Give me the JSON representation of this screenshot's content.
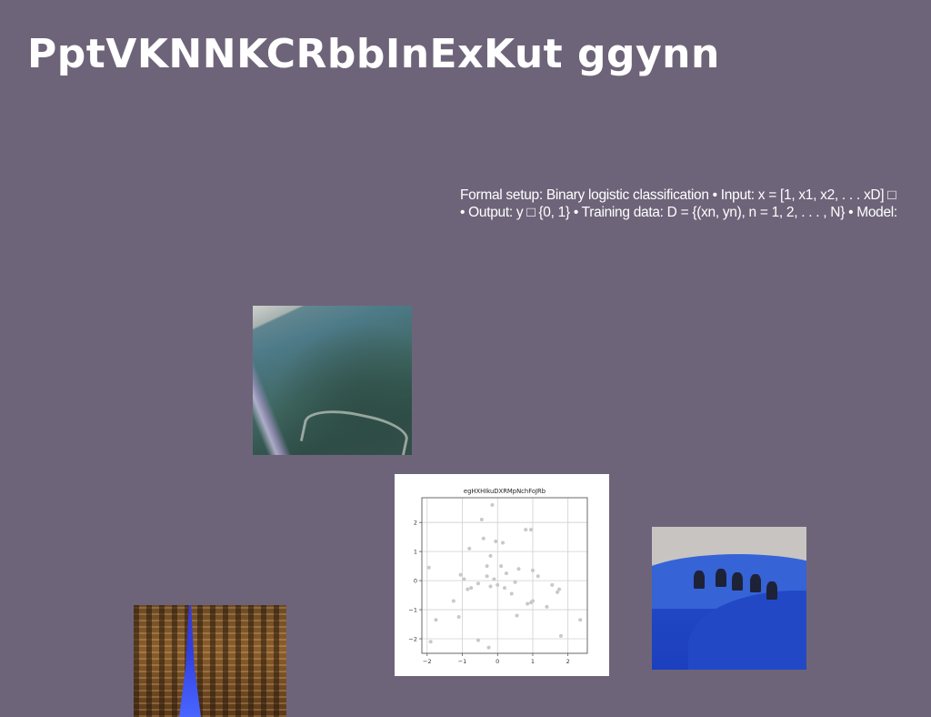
{
  "slide": {
    "title": "PptVKNNKCRbbInExKut ggynn",
    "body_line1": "Formal setup: Binary logistic classification • Input: x = [1, x1, x2, . . . xD] □",
    "body_line2": "• Output: y □ {0, 1} • Training data: D = {(xn, yn), n = 1, 2, . . . , N} • Model:"
  },
  "images": [
    {
      "name": "mountain-photo",
      "subject": "aerial mountain slope with road"
    },
    {
      "name": "camels-photo",
      "subject": "camel caravan on blue-toned dunes"
    },
    {
      "name": "city-photo",
      "subject": "night city with illuminated tower"
    }
  ],
  "chart_data": {
    "type": "scatter",
    "title": "egHXHIkuDXRMpNchFoJRb",
    "xlabel": "",
    "ylabel": "",
    "xlim": [
      -2.15,
      2.55
    ],
    "ylim": [
      -2.5,
      2.85
    ],
    "xticks": [
      "−2",
      "−1",
      "0",
      "1",
      "2"
    ],
    "xtick_values": [
      -2,
      -1,
      0,
      1,
      2
    ],
    "yticks": [
      "−2",
      "−1",
      "0",
      "1",
      "2"
    ],
    "ytick_values": [
      -2,
      -1,
      0,
      1,
      2
    ],
    "grid": true,
    "point_color": "#c8c8c8",
    "x": [
      -1.95,
      -1.9,
      -1.75,
      -1.25,
      -1.1,
      -1.05,
      -0.95,
      -0.85,
      -0.8,
      -0.75,
      -0.55,
      -0.55,
      -0.45,
      -0.4,
      -0.3,
      -0.3,
      -0.25,
      -0.2,
      -0.2,
      -0.15,
      -0.1,
      -0.05,
      0.0,
      0.1,
      0.15,
      0.2,
      0.25,
      0.4,
      0.5,
      0.55,
      0.6,
      0.8,
      0.85,
      0.95,
      0.95,
      1.0,
      1.0,
      1.15,
      1.4,
      1.55,
      1.7,
      1.75,
      1.8,
      2.35
    ],
    "y": [
      0.45,
      -2.1,
      -1.35,
      -0.7,
      -1.25,
      0.2,
      0.05,
      -0.3,
      1.1,
      -0.25,
      -0.1,
      -2.05,
      2.1,
      1.45,
      0.15,
      0.5,
      -2.3,
      0.85,
      -0.2,
      2.6,
      0.05,
      1.35,
      -0.15,
      0.5,
      1.3,
      -0.25,
      0.25,
      -0.45,
      -0.05,
      -1.2,
      0.4,
      1.75,
      -0.8,
      1.75,
      -0.75,
      0.35,
      -0.7,
      0.15,
      -0.9,
      -0.15,
      -0.4,
      -0.3,
      -1.9,
      -1.35
    ]
  }
}
